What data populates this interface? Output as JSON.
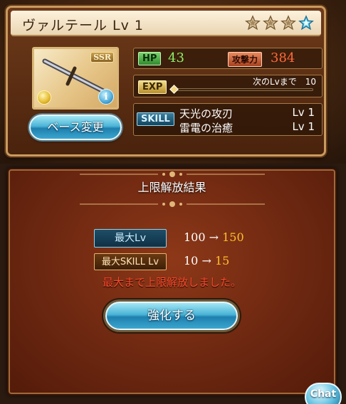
{
  "weapon": {
    "name": "ヴァルテール Lv 1",
    "rarity": "SSR",
    "stars": [
      {
        "state": "empty"
      },
      {
        "state": "empty"
      },
      {
        "state": "empty"
      },
      {
        "state": "filled"
      }
    ],
    "element_icon": "light-element-icon",
    "info_icon": "info-icon",
    "info_symbol": "i"
  },
  "base_button_label": "ベース変更",
  "stats": {
    "hp_label": "HP",
    "hp_value": "43",
    "atk_label": "攻撃力",
    "atk_value": "384",
    "exp_label": "EXP",
    "next_lv_text": "次のLvまで　10",
    "exp_progress": 0.0
  },
  "skills": {
    "label": "SKILL",
    "items": [
      {
        "name": "天光の攻刃",
        "level": "Lv 1"
      },
      {
        "name": "雷電の治癒",
        "level": "Lv 1"
      }
    ]
  },
  "result": {
    "title": "上限解放結果",
    "max_lv_label": "最大Lv",
    "max_lv_old": "100 →",
    "max_lv_new": "150",
    "max_skill_label": "最大SKILL Lv",
    "max_skill_old": "10 →",
    "max_skill_new": "15",
    "message": "最大まで上限解放しました。",
    "enhance_button_label": "強化する"
  },
  "chat_button_label": "Chat",
  "colors": {
    "accent_blue": "#4ab4d6",
    "hp_green": "#8ff067",
    "atk_red": "#ff6a3a",
    "new_value_gold": "#ffbf2a",
    "message_red": "#ff4a2a"
  }
}
